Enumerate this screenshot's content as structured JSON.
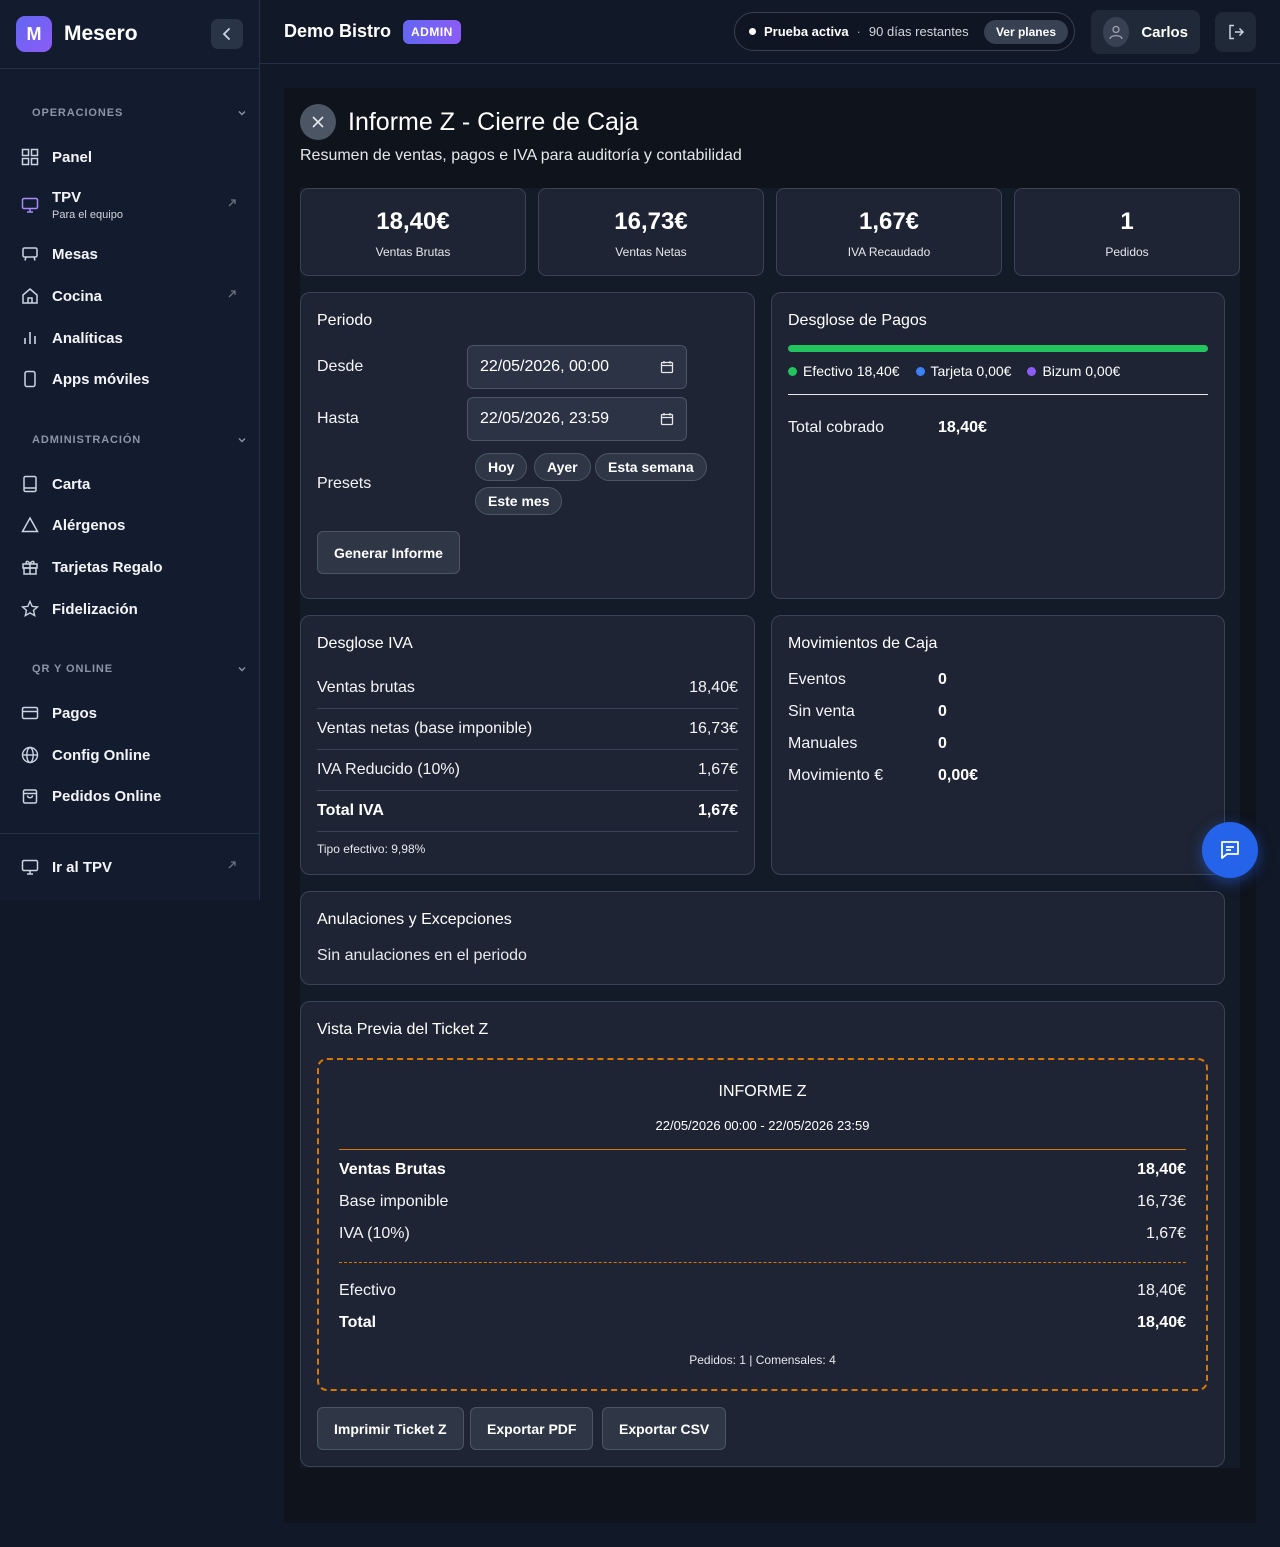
{
  "app": {
    "name": "Mesero",
    "logo_letter": "M"
  },
  "sidebar": {
    "sections": [
      {
        "title": "OPERACIONES",
        "items": [
          {
            "label": "Panel",
            "icon": "grid-icon"
          },
          {
            "label": "TPV",
            "sub": "Para el equipo",
            "icon": "monitor-icon",
            "external": true
          },
          {
            "label": "Mesas",
            "icon": "table-icon"
          },
          {
            "label": "Cocina",
            "icon": "home-icon",
            "external": true
          },
          {
            "label": "Analíticas",
            "icon": "bar-chart-icon"
          },
          {
            "label": "Apps móviles",
            "icon": "phone-icon"
          }
        ]
      },
      {
        "title": "ADMINISTRACIÓN",
        "items": [
          {
            "label": "Carta",
            "icon": "book-icon"
          },
          {
            "label": "Alérgenos",
            "icon": "warning-icon"
          },
          {
            "label": "Tarjetas Regalo",
            "icon": "gift-icon"
          },
          {
            "label": "Fidelización",
            "icon": "star-icon"
          }
        ]
      },
      {
        "title": "QR Y ONLINE",
        "items": [
          {
            "label": "Pagos",
            "icon": "card-icon"
          },
          {
            "label": "Config Online",
            "icon": "globe-icon"
          },
          {
            "label": "Pedidos Online",
            "icon": "bag-icon"
          }
        ]
      }
    ],
    "footer": {
      "label": "Ir al TPV"
    }
  },
  "topbar": {
    "venue": "Demo Bistro",
    "role_badge": "ADMIN",
    "trial": {
      "status": "Prueba activa",
      "separator": "·",
      "remaining": "90 días restantes",
      "cta": "Ver planes"
    },
    "user": "Carlos"
  },
  "report": {
    "title": "Informe Z - Cierre de Caja",
    "subtitle": "Resumen de ventas, pagos e IVA para auditoría y contabilidad",
    "stats": [
      {
        "value": "18,40€",
        "label": "Ventas Brutas"
      },
      {
        "value": "16,73€",
        "label": "Ventas Netas"
      },
      {
        "value": "1,67€",
        "label": "IVA Recaudado"
      },
      {
        "value": "1",
        "label": "Pedidos"
      }
    ],
    "period": {
      "title": "Periodo",
      "from_label": "Desde",
      "from_value": "22/05/2026, 00:00",
      "to_label": "Hasta",
      "to_value": "22/05/2026, 23:59",
      "presets_label": "Presets",
      "presets": [
        "Hoy",
        "Ayer",
        "Esta semana",
        "Este mes"
      ],
      "generate": "Generar Informe"
    },
    "payments": {
      "title": "Desglose de Pagos",
      "legend": [
        {
          "label": "Efectivo 18,40€",
          "color": "#22c55e",
          "fraction": 1.0
        },
        {
          "label": "Tarjeta 0,00€",
          "color": "#3b82f6",
          "fraction": 0
        },
        {
          "label": "Bizum 0,00€",
          "color": "#8b5cf6",
          "fraction": 0
        }
      ],
      "total_label": "Total cobrado",
      "total_value": "18,40€"
    },
    "iva": {
      "title": "Desglose IVA",
      "rows": [
        {
          "label": "Ventas brutas",
          "value": "18,40€"
        },
        {
          "label": "Ventas netas (base imponible)",
          "value": "16,73€"
        },
        {
          "label": "IVA Reducido (10%)",
          "value": "1,67€"
        },
        {
          "label": "Total IVA",
          "value": "1,67€"
        }
      ],
      "effective": "Tipo efectivo: 9,98%"
    },
    "cash": {
      "title": "Movimientos de Caja",
      "rows": [
        {
          "label": "Eventos",
          "value": "0"
        },
        {
          "label": "Sin venta",
          "value": "0"
        },
        {
          "label": "Manuales",
          "value": "0"
        },
        {
          "label": "Movimiento €",
          "value": "0,00€"
        }
      ]
    },
    "voids": {
      "title": "Anulaciones y Excepciones",
      "empty": "Sin anulaciones en el periodo"
    },
    "ticket": {
      "title": "Vista Previa del Ticket Z",
      "heading": "INFORME Z",
      "range": "22/05/2026 00:00 - 22/05/2026 23:59",
      "rows": [
        {
          "label": "Ventas Brutas",
          "value": "18,40€"
        },
        {
          "label": "Base imponible",
          "value": "16,73€"
        },
        {
          "label": "IVA (10%)",
          "value": "1,67€"
        }
      ],
      "pay_rows": [
        {
          "label": "Efectivo",
          "value": "18,40€"
        },
        {
          "label": "Total",
          "value": "18,40€"
        }
      ],
      "footer": "Pedidos: 1 | Comensales: 4"
    },
    "actions": [
      "Imprimir Ticket Z",
      "Exportar PDF",
      "Exportar CSV"
    ]
  }
}
